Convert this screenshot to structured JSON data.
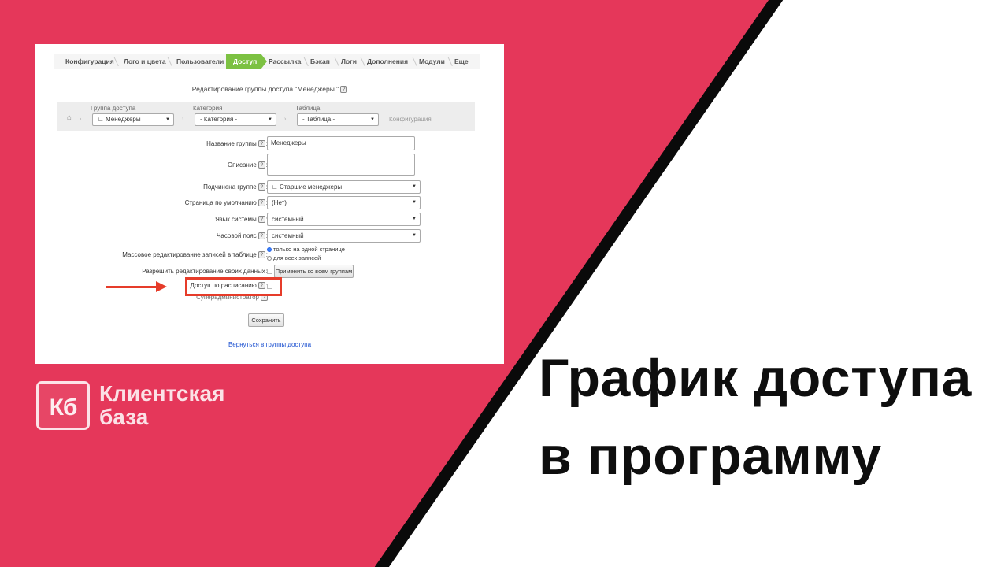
{
  "colors": {
    "brand_red": "#e5375a",
    "divider": "#0a0a0a",
    "active_tab": "#7cc142",
    "highlight": "#e63c2a"
  },
  "nav": {
    "tabs": [
      "Конфигурация",
      "Лого и цвета",
      "Пользователи",
      "Доступ",
      "Рассылка",
      "Бэкап",
      "Логи",
      "Дополнения",
      "Модули",
      "Еще"
    ],
    "active": "Доступ"
  },
  "form": {
    "title": "Редактирование группы доступа \"Менеджеры \"",
    "filter": {
      "group_label": "Группа доступа",
      "group_value": "∟ Менеджеры",
      "category_label": "Категория",
      "category_value": "- Категория -",
      "table_label": "Таблица",
      "table_value": "- Таблица -",
      "config_link": "Конфигурация"
    },
    "fields": {
      "name_label": "Название группы",
      "name_value": "Менеджеры",
      "desc_label": "Описание",
      "parent_label": "Подчинена группе",
      "parent_value": "∟ Старшие менеджеры",
      "default_page_label": "Страница по умолчанию",
      "default_page_value": "(Нет)",
      "language_label": "Язык системы",
      "language_value": "системный",
      "timezone_label": "Часовой пояс",
      "timezone_value": "системный",
      "mass_edit_label": "Массовое редактирование записей в таблице",
      "mass_edit_opt1": "только на одной странице",
      "mass_edit_opt2": "для всех записей",
      "allow_edit_label": "Разрешить редактирование своих данных",
      "apply_all_button": "Применить ко всем группам",
      "schedule_label": "Доступ по расписанию",
      "superadmin_label": "Суперадминистратор"
    },
    "save_button": "Сохранить",
    "back_link": "Вернуться в группы доступа",
    "help_glyph": "?"
  },
  "logo": {
    "mark": "Кб",
    "line1": "Клиентская",
    "line2": "база"
  },
  "headline": {
    "line1": "График доступа",
    "line2": "в программу"
  }
}
